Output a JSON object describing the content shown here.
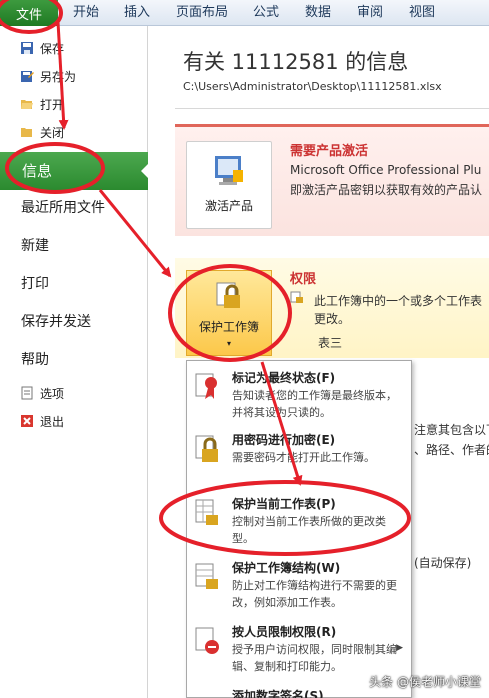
{
  "ribbon": {
    "file_tab": "文件",
    "tabs": [
      "开始",
      "插入",
      "页面布局",
      "公式",
      "数据",
      "审阅",
      "视图"
    ]
  },
  "nav": {
    "save": "保存",
    "save_as": "另存为",
    "open": "打开",
    "close": "关闭",
    "info": "信息",
    "recent": "最近所用文件",
    "new": "新建",
    "print": "打印",
    "save_send": "保存并发送",
    "help": "帮助",
    "options": "选项",
    "exit": "退出"
  },
  "main": {
    "title": "有关 11112581 的信息",
    "path": "C:\\Users\\Administrator\\Desktop\\11112581.xlsx",
    "activate": {
      "button_label": "激活产品",
      "heading": "需要产品激活",
      "line1": "Microsoft Office Professional Plu",
      "line2": "即激活产品密钥以获取有效的产品认"
    },
    "permissions": {
      "button_label": "保护工作簿",
      "heading": "权限",
      "line1": "此工作簿中的一个或多个工作表",
      "line2": "更改。",
      "sheet": "表三"
    },
    "bg_fragments": {
      "a": "注意其包含以下",
      "b": "、路径、作者的",
      "c": "(自动保存)"
    }
  },
  "menu": {
    "items": [
      {
        "title": "标记为最终状态(F)",
        "desc": "告知读者您的工作簿是最终版本，并将其设为只读的。"
      },
      {
        "title": "用密码进行加密(E)",
        "desc": "需要密码才能打开此工作簿。"
      },
      {
        "title": "保护当前工作表(P)",
        "desc": "控制对当前工作表所做的更改类型。"
      },
      {
        "title": "保护工作簿结构(W)",
        "desc": "防止对工作簿结构进行不需要的更改，例如添加工作表。"
      },
      {
        "title": "按人员限制权限(R)",
        "desc": "授予用户访问权限，同时限制其编辑、复制和打印能力。"
      },
      {
        "title": "添加数字签名(S)",
        "desc": ""
      }
    ]
  },
  "watermark": "头条 @侯老师小课堂",
  "colors": {
    "file_tab": "#2b8a2f",
    "annotation_red": "#e5202a",
    "activate_accent": "#c33333",
    "protect_button": "#fcc84a"
  }
}
